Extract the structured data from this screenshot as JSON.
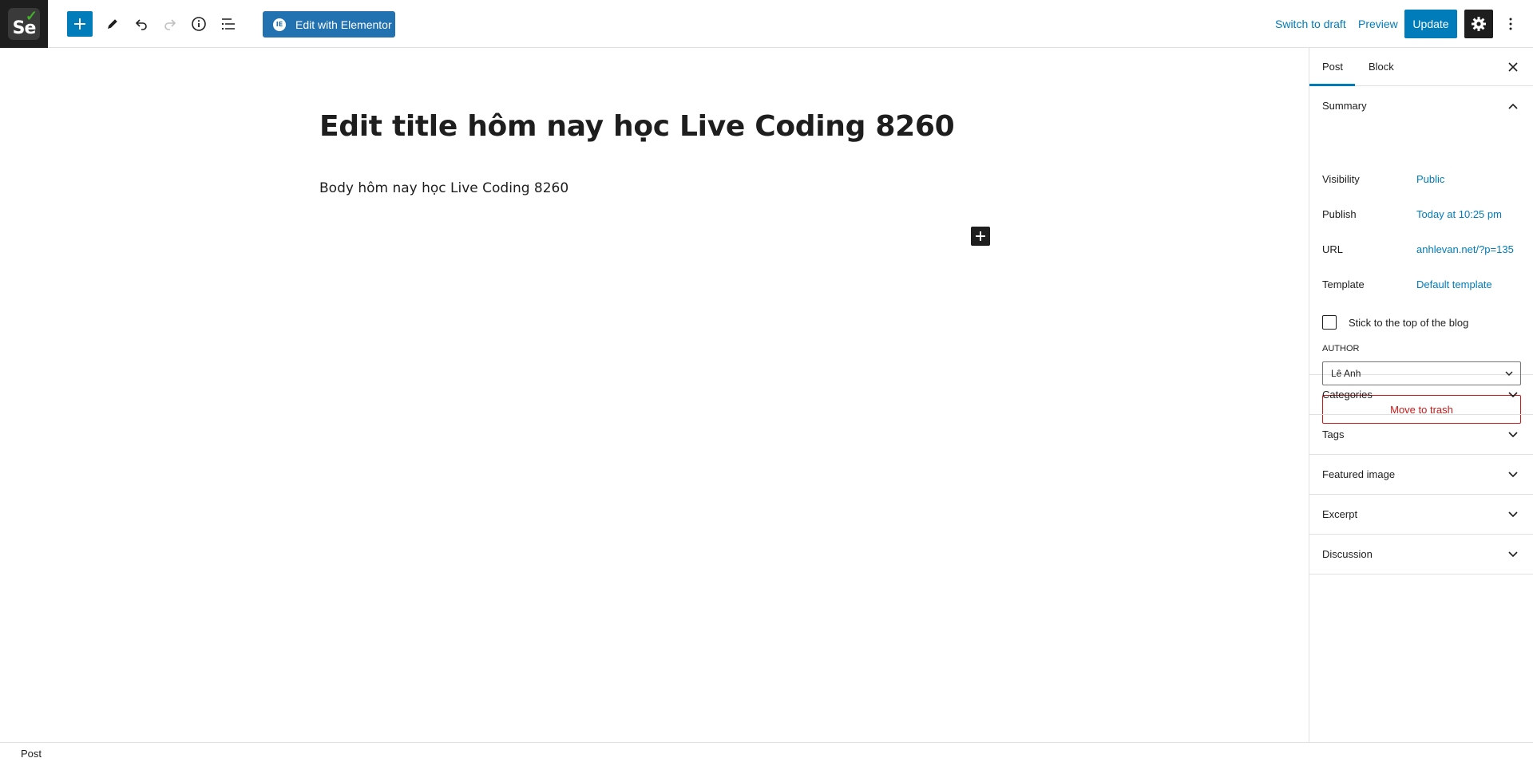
{
  "toolbar": {
    "site_logo_text": "Se",
    "elementor_label": "Edit with Elementor",
    "elementor_icon_text": "IE",
    "switch_to_draft": "Switch to draft",
    "preview": "Preview",
    "update": "Update",
    "icons": [
      "plus-icon",
      "pencil-icon",
      "undo-icon",
      "redo-icon",
      "info-icon",
      "list-view-icon",
      "gear-icon",
      "kebab-menu-icon"
    ]
  },
  "editor": {
    "title": "Edit title hôm nay học Live Coding 8260",
    "body": "Body hôm nay học Live Coding 8260"
  },
  "sidebar": {
    "tabs": [
      "Post",
      "Block"
    ],
    "active_tab": "Post",
    "summary": {
      "heading": "Summary",
      "rows": [
        {
          "label": "Visibility",
          "value": "Public"
        },
        {
          "label": "Publish",
          "value": "Today at 10:25 pm"
        },
        {
          "label": "URL",
          "value": "anhlevan.net/?p=135"
        },
        {
          "label": "Template",
          "value": "Default template"
        }
      ],
      "stick_label": "Stick to the top of the blog",
      "stick_checked": false,
      "author_label": "AUTHOR",
      "author_value": "Lê Anh",
      "trash_label": "Move to trash"
    },
    "panels": [
      "Categories",
      "Tags",
      "Featured image",
      "Excerpt",
      "Discussion"
    ]
  },
  "footer": {
    "breadcrumb": "Post"
  },
  "colors": {
    "accent": "#007cba",
    "elementor": "#2271b1",
    "danger": "#cc1818",
    "dark": "#1e1e1e"
  }
}
